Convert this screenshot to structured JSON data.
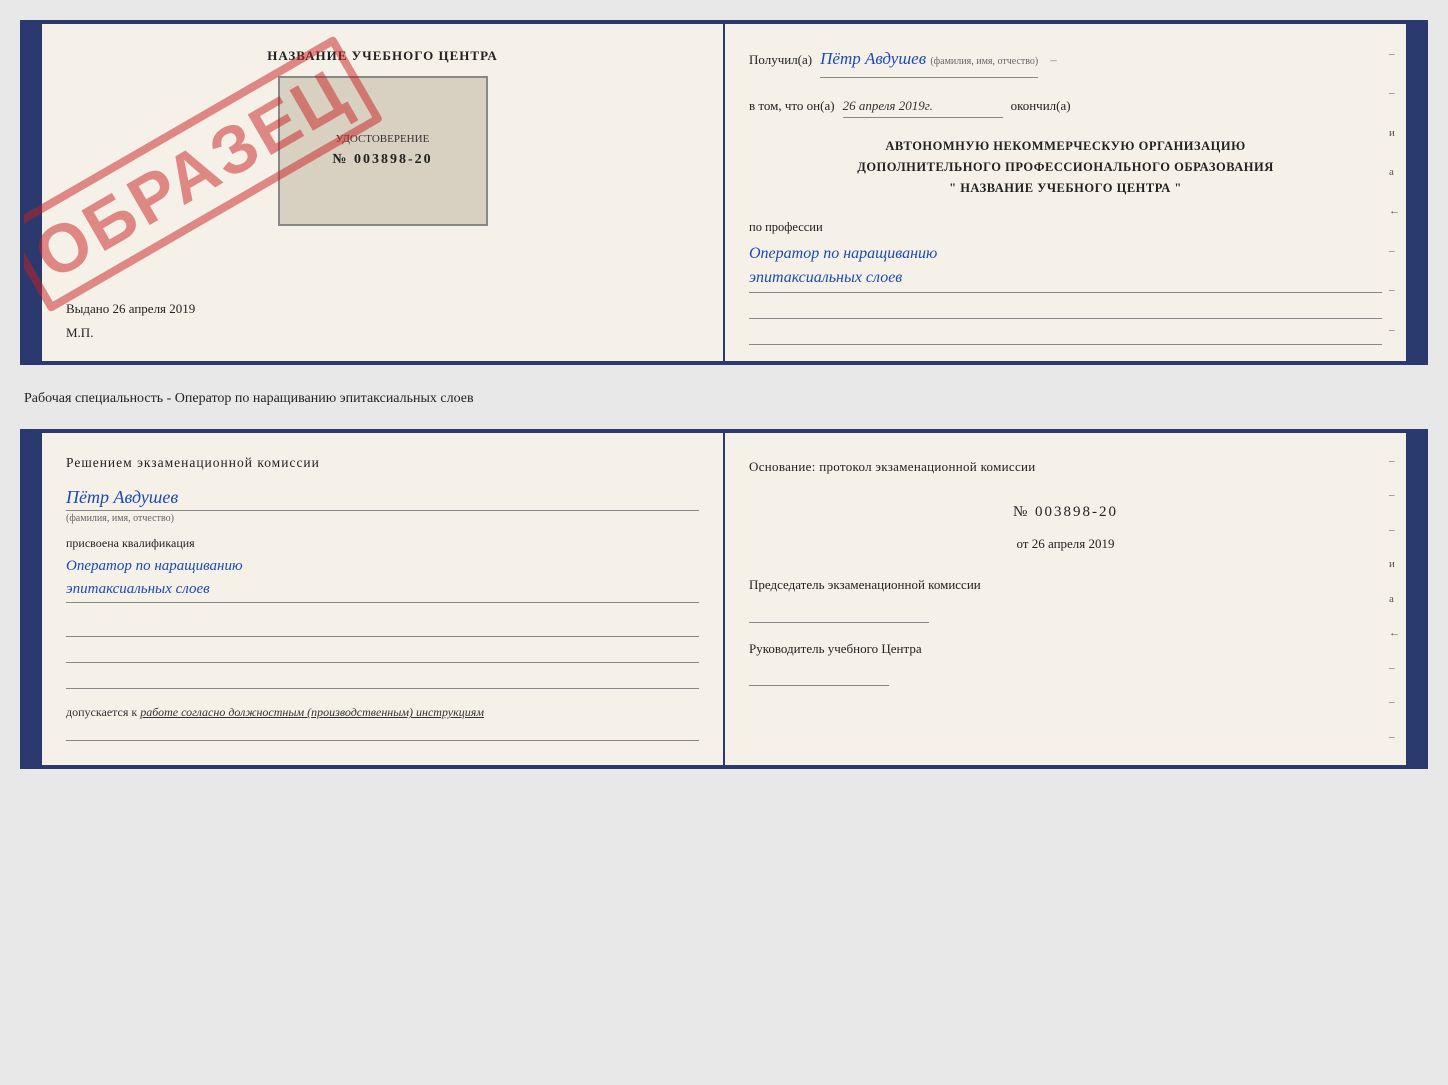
{
  "page": {
    "background": "#e8e8e8"
  },
  "specialty_text": "Рабочая специальность - Оператор по наращиванию эпитаксиальных слоев",
  "card1": {
    "left": {
      "training_center_title": "НАЗВАНИЕ УЧЕБНОГО ЦЕНТРА",
      "stamp_text": "ОБРАЗЕЦ",
      "cert_label": "УДОСТОВЕРЕНИЕ",
      "cert_number": "№ 003898-20",
      "vydano": "Выдано 26 апреля 2019",
      "mp": "М.П."
    },
    "right": {
      "recipient_label": "Получил(а)",
      "recipient_name": "Пётр Авдушев",
      "recipient_subtitle": "(фамилия, имя, отчество)",
      "dash": "–",
      "date_label": "в том, что он(а)",
      "date_value": "26 апреля 2019г.",
      "finished_label": "окончил(а)",
      "org_line1": "АВТОНОМНУЮ НЕКОММЕРЧЕСКУЮ ОРГАНИЗАЦИЮ",
      "org_line2": "ДОПОЛНИТЕЛЬНОГО ПРОФЕССИОНАЛЬНОГО ОБРАЗОВАНИЯ",
      "org_line3": "\"  НАЗВАНИЕ УЧЕБНОГО ЦЕНТРА  \"",
      "profession_label": "по профессии",
      "profession_line1": "Оператор по наращиванию",
      "profession_line2": "эпитаксиальных слоев",
      "side_marks": [
        "–",
        "–",
        "и",
        "а",
        "←",
        "–",
        "–",
        "–"
      ]
    }
  },
  "card2": {
    "left": {
      "exam_title": "Решением  экзаменационной  комиссии",
      "person_name": "Пётр Авдушев",
      "fio_subtitle": "(фамилия, имя, отчество)",
      "assigned_label": "присвоена квалификация",
      "qualification_line1": "Оператор по наращиванию",
      "qualification_line2": "эпитаксиальных слоев",
      "допуск_label": "допускается к",
      "допуск_value": "работе согласно должностным (производственным) инструкциям"
    },
    "right": {
      "osnov_label": "Основание: протокол экзаменационной  комиссии",
      "protocol_label": "№",
      "protocol_number": "003898-20",
      "date_prefix": "от",
      "protocol_date": "26 апреля 2019",
      "chairman_label": "Председатель экзаменационной комиссии",
      "rukov_label": "Руководитель учебного Центра",
      "side_marks": [
        "–",
        "–",
        "–",
        "и",
        "а",
        "←",
        "–",
        "–",
        "–"
      ]
    }
  }
}
